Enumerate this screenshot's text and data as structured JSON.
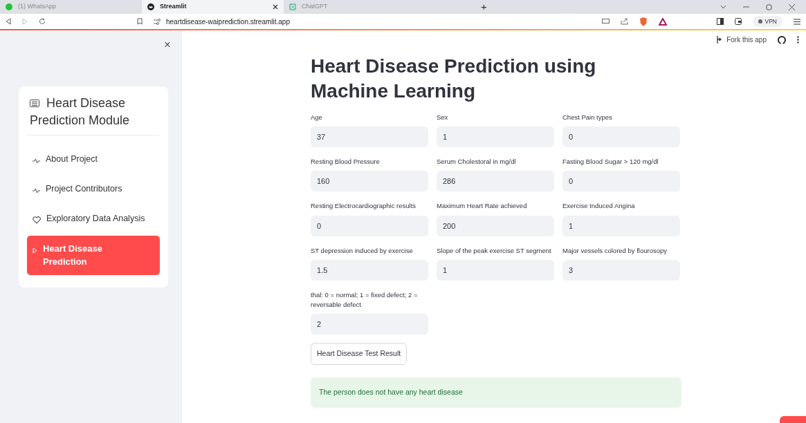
{
  "browser": {
    "tabs": [
      {
        "label": "(1) WhatsApp",
        "selected": false,
        "kind": "whatsapp"
      },
      {
        "label": "Streamlit",
        "selected": true,
        "kind": "streamlit"
      },
      {
        "label": "ChatGPT",
        "selected": false,
        "kind": "chatgpt"
      }
    ],
    "new_tab": "+",
    "url": "heartdisease-waiprediction.streamlit.app",
    "vpn": "VPN"
  },
  "header": {
    "fork": "Fork this app"
  },
  "sidebar": {
    "close": "×",
    "title": "Heart Disease Prediction Module",
    "items": [
      {
        "label": "About Project",
        "kind": "pulse",
        "selected": false
      },
      {
        "label": "Project Contributors",
        "kind": "pulse",
        "selected": false
      },
      {
        "label": "Exploratory Data Analysis",
        "kind": "heart",
        "selected": false
      },
      {
        "label": "Heart Disease Prediction",
        "kind": "play",
        "selected": true
      }
    ]
  },
  "main": {
    "title": "Heart Disease Prediction using Machine Learning",
    "fields": [
      {
        "label": "Age",
        "value": "37"
      },
      {
        "label": "Sex",
        "value": "1"
      },
      {
        "label": "Chest Pain types",
        "value": "0"
      },
      {
        "label": "Resting Blood Pressure",
        "value": "160"
      },
      {
        "label": "Serum Cholestoral in mg/dl",
        "value": "286"
      },
      {
        "label": "Fasting Blood Sugar > 120 mg/dl",
        "value": "0"
      },
      {
        "label": "Resting Electrocardiographic results",
        "value": "0"
      },
      {
        "label": "Maximum Heart Rate achieved",
        "value": "200"
      },
      {
        "label": "Exercise Induced Angina",
        "value": "1"
      },
      {
        "label": "ST depression induced by exercise",
        "value": "1.5"
      },
      {
        "label": "Slope of the peak exercise ST segment",
        "value": "1"
      },
      {
        "label": "Major vessels colored by flourosopy",
        "value": "3"
      },
      {
        "label": "thal: 0 = normal; 1 = fixed defect; 2 = reversable defect",
        "value": "2"
      }
    ],
    "button": "Heart Disease Test Result",
    "result": "The person does not have any heart disease"
  }
}
